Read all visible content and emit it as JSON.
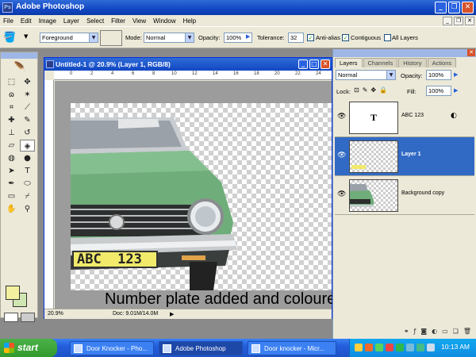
{
  "app": {
    "title": "Adobe Photoshop"
  },
  "menu": [
    "File",
    "Edit",
    "Image",
    "Layer",
    "Select",
    "Filter",
    "View",
    "Window",
    "Help"
  ],
  "options": {
    "fill_source": "Foreground",
    "mode_label": "Mode:",
    "mode_value": "Normal",
    "opacity_label": "Opacity:",
    "opacity_value": "100%",
    "tolerance_label": "Tolerance:",
    "tolerance_value": "32",
    "antialias_label": "Anti-alias",
    "contiguous_label": "Contiguous",
    "all_layers_label": "All Layers"
  },
  "document": {
    "title": "Untitled-1 @ 20.9% (Layer 1, RGB/8)",
    "ruler_marks": [
      "0",
      "2",
      "4",
      "6",
      "8",
      "10",
      "12",
      "14",
      "16",
      "18",
      "20",
      "22",
      "24"
    ],
    "zoom": "20.9%",
    "doc_info": "Doc: 9.01M/14.0M"
  },
  "plate_text": "ABC  123",
  "caption": "Number plate added and coloured",
  "layers_panel": {
    "tabs": [
      "Layers",
      "Channels",
      "History",
      "Actions"
    ],
    "blend_mode": "Normal",
    "opacity_label": "Opacity:",
    "opacity_value": "100%",
    "lock_label": "Lock:",
    "fill_label": "Fill:",
    "fill_value": "100%",
    "layers": [
      {
        "name": "ABC   123",
        "thumb": "T"
      },
      {
        "name": "Layer 1",
        "selected": true
      },
      {
        "name": "Background copy"
      }
    ]
  },
  "taskbar": {
    "start": "start",
    "tasks": [
      "Door Knocker - Pho...",
      "Adobe Photoshop",
      "Door knocker - Micr..."
    ],
    "clock": "10:13 AM"
  },
  "colors": {
    "foreground": "#f3f0a0",
    "background": "#cfe6b2",
    "selection": "#316ac5",
    "car_body": "#6fae7a",
    "plate": "#f1ea6b"
  }
}
